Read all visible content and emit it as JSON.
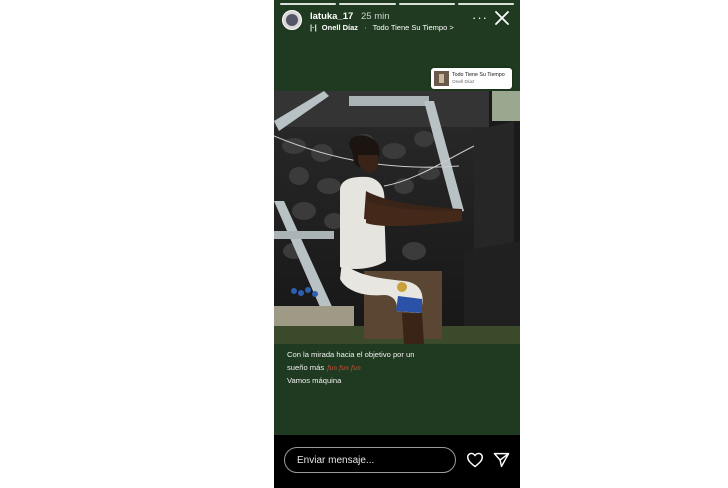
{
  "story": {
    "username": "latuka_17",
    "time": "25 min",
    "music": {
      "artist": "Onell Díaz",
      "separator": "·",
      "song": "Todo Tiene Su Tiempo",
      "arrow": ">"
    },
    "more": "···",
    "sticker": {
      "title": "Todo Tiene Su Tiempo",
      "artist": "Onell Díaz"
    },
    "caption": {
      "line1": "Con la mirada hacia el objetivo por un",
      "line2": "sueño más",
      "line2_handwritten": "fun fun fun",
      "line3": "Vamos máquina"
    },
    "reply": {
      "placeholder": "Enviar mensaje..."
    },
    "progress_segments": 4,
    "colors": {
      "background": "#1f3a20",
      "bottom_bar": "#000000"
    }
  }
}
